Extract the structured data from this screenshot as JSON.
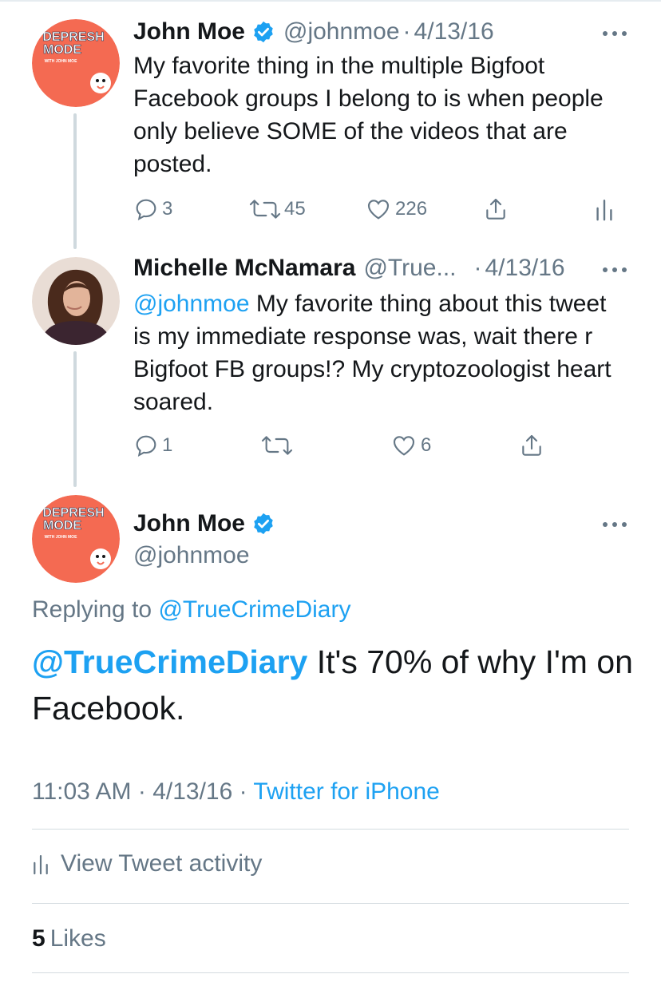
{
  "colors": {
    "link": "#1da1f2",
    "muted": "#657786",
    "text": "#14171a",
    "avatar_orange": "#f46a52",
    "verified": "#1da1f2"
  },
  "tweet1": {
    "author_name": "John Moe",
    "verified": true,
    "handle": "@johnmoe",
    "date": "4/13/16",
    "avatar_text_line1": "DEPRESH",
    "avatar_text_line2": "MODE",
    "avatar_text_line3": "WITH JOHN MOE",
    "text": "My favorite thing in the multiple Bigfoot Facebook groups I belong to is when people only believe SOME of the videos that are posted.",
    "replies": "3",
    "retweets": "45",
    "likes": "226",
    "icons": [
      "reply-icon",
      "retweet-icon",
      "like-icon",
      "share-icon",
      "analytics-icon",
      "more-icon"
    ]
  },
  "tweet2": {
    "author_name": "Michelle McNamara",
    "handle": "@True...",
    "date": "4/13/16",
    "mention": "@johnmoe",
    "text": " My favorite thing about this tweet is my immediate response was, wait there r Bigfoot FB groups!? My cryptozoologist heart soared.",
    "replies": "1",
    "likes": "6"
  },
  "main_tweet": {
    "author_name": "John Moe",
    "verified": true,
    "handle": "@johnmoe",
    "replying_to_label": "Replying to ",
    "replying_to_handle": "@TrueCrimeDiary",
    "mention": "@TrueCrimeDiary",
    "text": " It's 70% of why I'm on Facebook.",
    "time": "11:03 AM",
    "date": "4/13/16",
    "source": "Twitter for iPhone",
    "view_activity_label": "View Tweet activity",
    "likes_count": "5",
    "likes_label": "Likes"
  }
}
